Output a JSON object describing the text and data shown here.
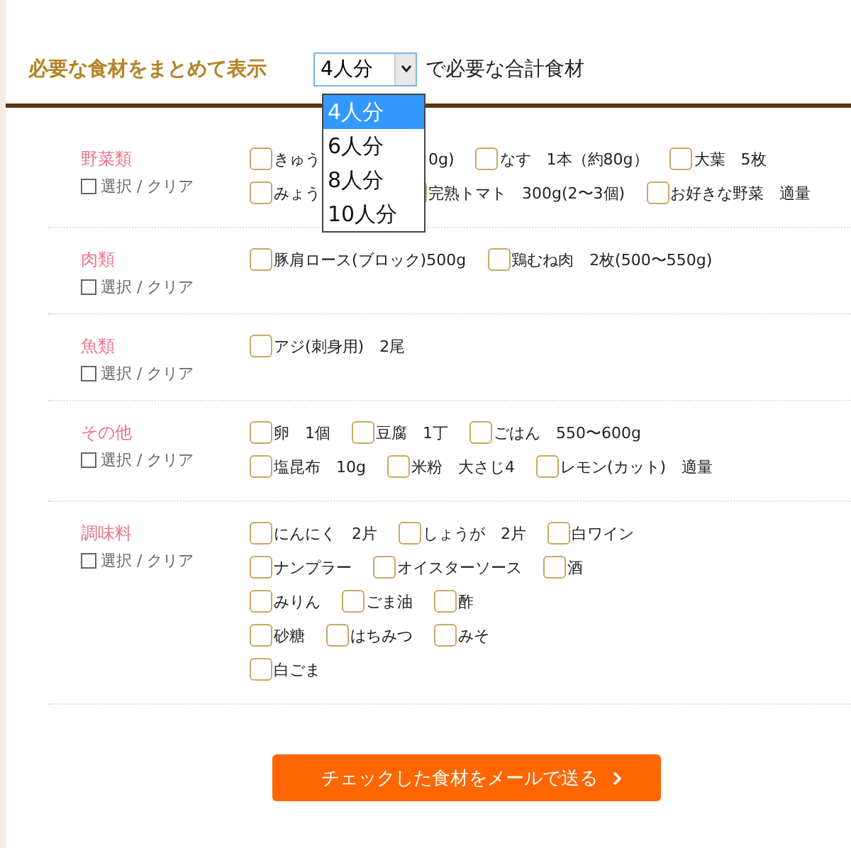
{
  "header": {
    "title": "必要な食材をまとめて表示",
    "select": {
      "value": "4人分",
      "open": true,
      "options": [
        {
          "label": "4人分",
          "selected": true
        },
        {
          "label": "6人分",
          "selected": false
        },
        {
          "label": "8人分",
          "selected": false
        },
        {
          "label": "10人分",
          "selected": false
        }
      ]
    },
    "suffix": "で必要な合計食材"
  },
  "categories": [
    {
      "name": "野菜類",
      "select_all": {
        "label": "選択 / クリア",
        "checked": false
      },
      "rows": [
        [
          {
            "label": "きゅう",
            "label_after_gap": "0g)",
            "checked": false
          },
          {
            "label": "なす　1本（約80g）",
            "checked": false
          },
          {
            "label": "大葉　5枚",
            "checked": false
          }
        ],
        [
          {
            "label": "みょう",
            "hidden_after": true,
            "checked": false
          },
          {
            "label": "完熟トマト　300g(2〜3個)",
            "checked": false
          },
          {
            "label": "お好きな野菜　適量",
            "checked": false
          }
        ]
      ]
    },
    {
      "name": "肉類",
      "select_all": {
        "label": "選択 / クリア",
        "checked": false
      },
      "rows": [
        [
          {
            "label": "豚肩ロース(ブロック)500g",
            "checked": false
          },
          {
            "label": "鶏むね肉　2枚(500〜550g)",
            "checked": false
          }
        ]
      ]
    },
    {
      "name": "魚類",
      "select_all": {
        "label": "選択 / クリア",
        "checked": false
      },
      "rows": [
        [
          {
            "label": "アジ(刺身用)　2尾",
            "checked": false
          }
        ]
      ]
    },
    {
      "name": "その他",
      "select_all": {
        "label": "選択 / クリア",
        "checked": false
      },
      "rows": [
        [
          {
            "label": "卵　1個",
            "checked": false
          },
          {
            "label": "豆腐　1丁",
            "checked": false
          },
          {
            "label": "ごはん　550〜600g",
            "checked": false
          }
        ],
        [
          {
            "label": "塩昆布　10g",
            "checked": false
          },
          {
            "label": "米粉　大さじ4",
            "checked": false
          },
          {
            "label": "レモン(カット)　適量",
            "checked": false
          }
        ]
      ]
    },
    {
      "name": "調味料",
      "select_all": {
        "label": "選択 / クリア",
        "checked": false
      },
      "rows": [
        [
          {
            "label": "にんにく　2片",
            "checked": false
          },
          {
            "label": "しょうが　2片",
            "checked": false
          },
          {
            "label": "白ワイン",
            "checked": false
          }
        ],
        [
          {
            "label": "ナンプラー",
            "checked": false
          },
          {
            "label": "オイスターソース",
            "checked": false
          },
          {
            "label": "酒",
            "checked": false
          }
        ],
        [
          {
            "label": "みりん",
            "checked": false
          },
          {
            "label": "ごま油",
            "checked": false
          },
          {
            "label": "酢",
            "checked": false
          }
        ],
        [
          {
            "label": "砂糖",
            "checked": false
          },
          {
            "label": "はちみつ",
            "checked": false
          },
          {
            "label": "みそ",
            "checked": false
          }
        ],
        [
          {
            "label": "白ごま",
            "checked": false
          }
        ]
      ]
    }
  ],
  "send_button": "チェックした食材をメールで送る"
}
